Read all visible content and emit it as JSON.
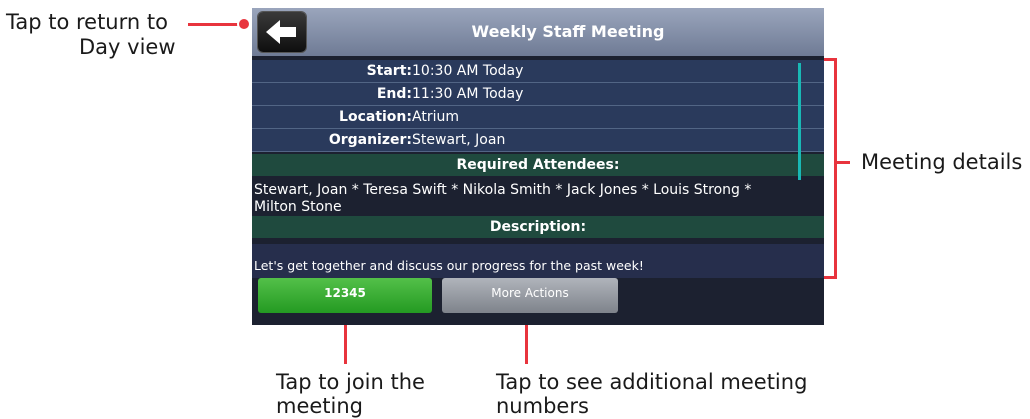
{
  "screen": {
    "back_icon": "back-arrow-icon",
    "title": "Weekly Staff Meeting",
    "details": [
      {
        "label": "Start:",
        "value": "10:30 AM Today"
      },
      {
        "label": "End:",
        "value": "11:30 AM Today"
      },
      {
        "label": "Location:",
        "value": "Atrium"
      },
      {
        "label": "Organizer:",
        "value": "Stewart, Joan"
      }
    ],
    "attendees_heading": "Required Attendees:",
    "attendees_line1": "Stewart, Joan * Teresa Swift * Nikola Smith * Jack Jones * Louis Strong *",
    "attendees_line2": "Milton Stone",
    "description_heading": "Description:",
    "description": "Let's get together and discuss our progress for the past week!",
    "join_button": "12345",
    "more_actions_button": "More Actions"
  },
  "callouts": {
    "back_line1": "Tap to return to",
    "back_line2": "Day view",
    "details": "Meeting details",
    "join_line1": "Tap to join the",
    "join_line2": "meeting",
    "more_line1": "Tap to see additional meeting",
    "more_line2": "numbers"
  },
  "colors": {
    "callout_accent": "#e8343d",
    "join_button": "#2fa52b",
    "section_head": "#1f4a3e",
    "detail_row": "#2a3a5c"
  }
}
